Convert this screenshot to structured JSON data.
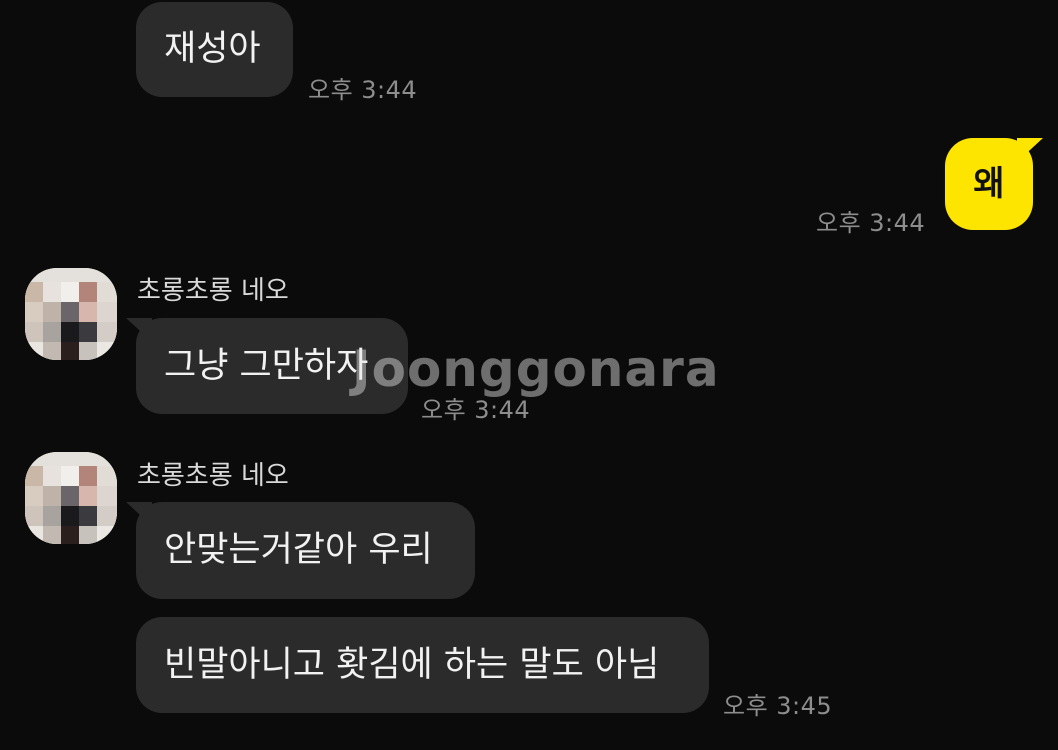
{
  "messages": [
    {
      "text": "재성아",
      "time": "오후 3:44"
    },
    {
      "text": "왜",
      "time": "오후 3:44"
    },
    {
      "sender": "초롱초롱 네오",
      "text": "그냥 그만하자",
      "time": "오후 3:44"
    },
    {
      "sender": "초롱초롱 네오",
      "text": "안맞는거같아 우리"
    },
    {
      "text": "빈말아니고 홧김에 하는 말도 아님",
      "time": "오후 3:45"
    }
  ],
  "watermark": "Joonggonara",
  "colors": {
    "background": "#0b0b0b",
    "incoming_bubble": "#2b2b2b",
    "outgoing_bubble": "#fee500",
    "timestamp": "#8d8d8d"
  },
  "icons": [
    "avatar-pixelated"
  ]
}
